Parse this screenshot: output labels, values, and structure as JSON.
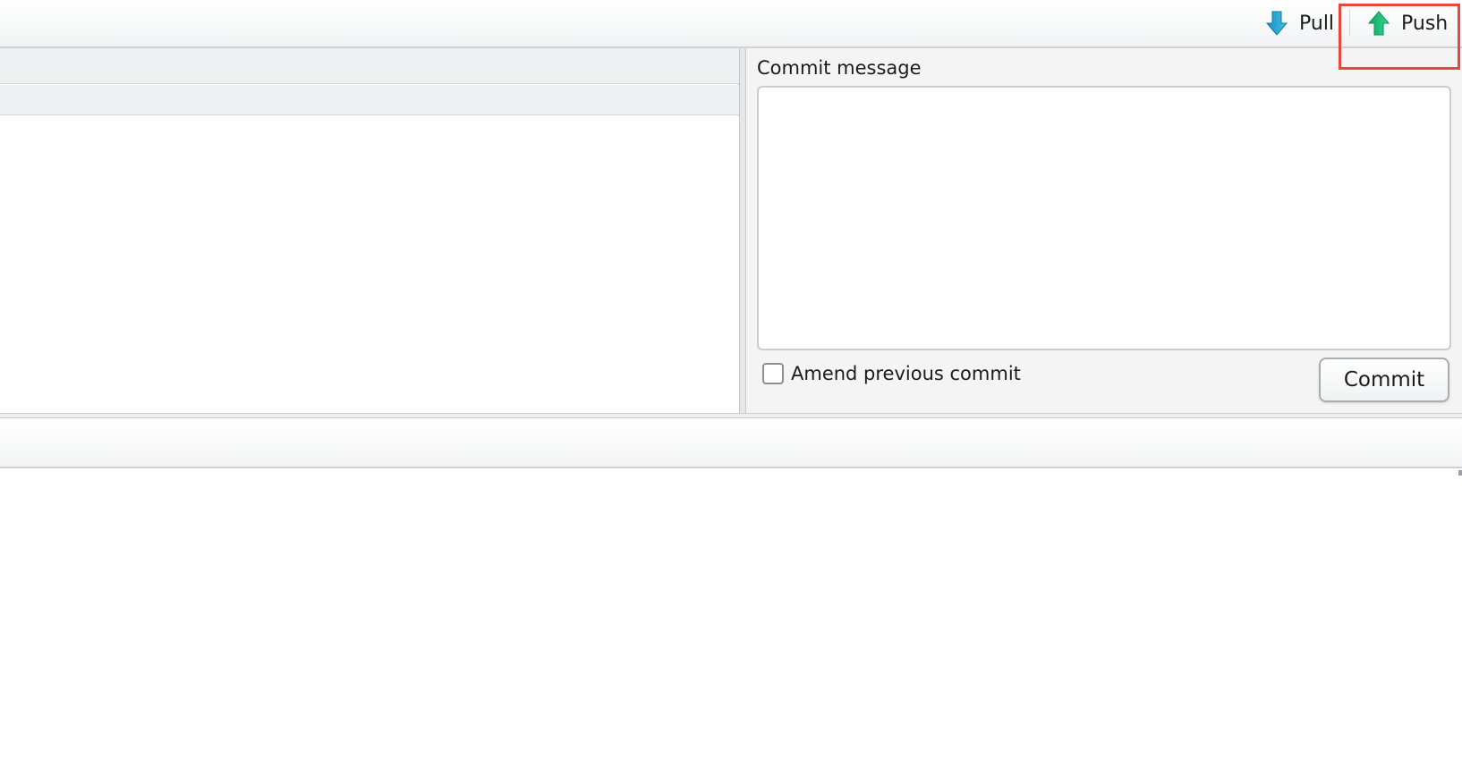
{
  "toolbar": {
    "pull_label": "Pull",
    "push_label": "Push",
    "pull_icon": "arrow-down-icon",
    "push_icon": "arrow-up-icon",
    "pull_icon_color": "#1aa0d0",
    "push_icon_color": "#16c27a"
  },
  "commit_panel": {
    "message_label": "Commit message",
    "message_value": "",
    "amend_label": "Amend previous commit",
    "amend_checked": false,
    "commit_button_label": "Commit"
  },
  "highlight": {
    "target": "push-button",
    "color": "#e8483b"
  }
}
